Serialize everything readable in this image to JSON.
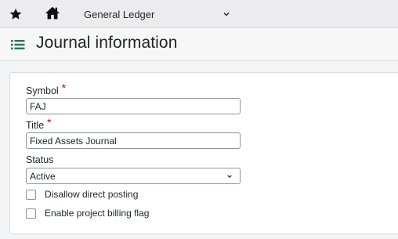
{
  "topbar": {
    "favorites_icon": "star-icon",
    "home_icon": "home-icon",
    "app_selector": "General Ledger",
    "app_selector_icon": "chevron-down-icon"
  },
  "header": {
    "menu_icon": "list-icon",
    "title": "Journal information"
  },
  "form": {
    "symbol": {
      "label": "Symbol",
      "required_mark": "*",
      "value": "FAJ"
    },
    "title": {
      "label": "Title",
      "required_mark": "*",
      "value": "Fixed Assets Journal"
    },
    "status": {
      "label": "Status",
      "value": "Active"
    },
    "checkboxes": [
      {
        "label": "Disallow direct posting",
        "checked": false
      },
      {
        "label": "Enable project billing flag",
        "checked": false
      }
    ]
  },
  "colors": {
    "accent_green": "#1e7d52",
    "required_red": "#c00000"
  }
}
